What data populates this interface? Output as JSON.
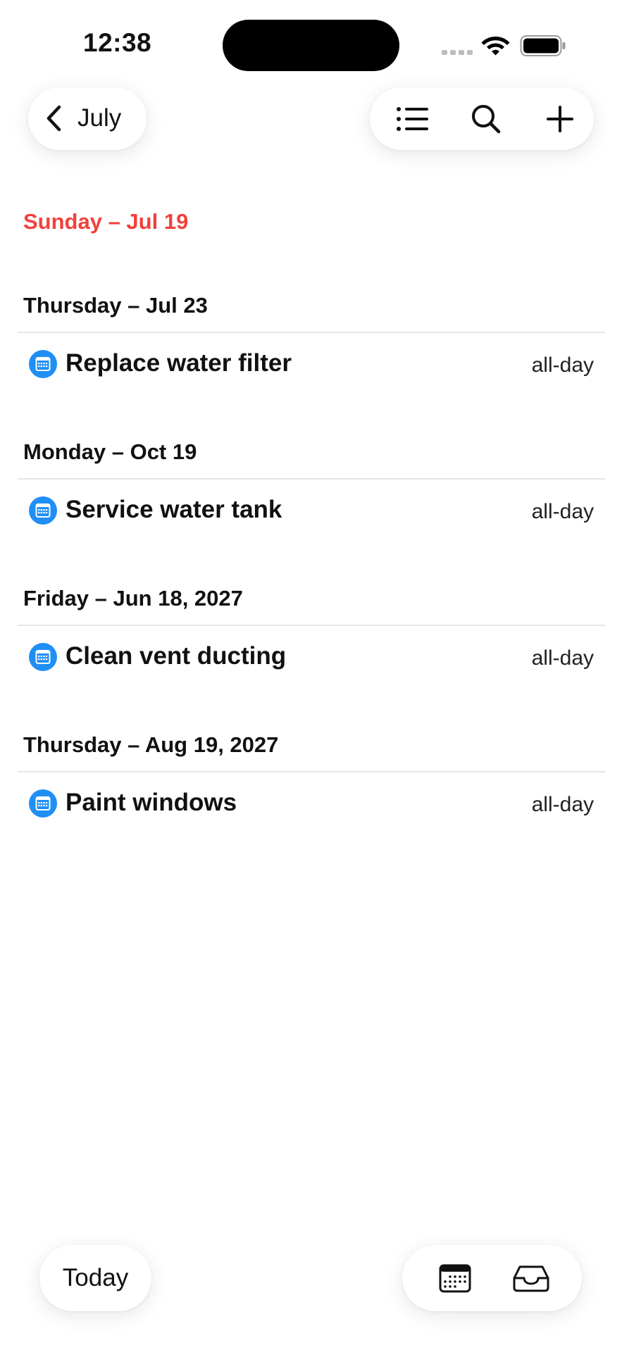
{
  "status_bar": {
    "time": "12:38"
  },
  "nav": {
    "back_label": "July",
    "icons": [
      "chevron-left-icon",
      "list-icon",
      "search-icon",
      "plus-icon"
    ]
  },
  "colors": {
    "today_header": "#f1413c",
    "event_icon": "#1f8ff5",
    "text": "#111111"
  },
  "days": [
    {
      "header": "Sunday – Jul 19",
      "is_today": true,
      "events": []
    },
    {
      "header": "Thursday – Jul 23",
      "is_today": false,
      "events": [
        {
          "title": "Replace water filter",
          "time": "all-day",
          "icon": "calendar-icon"
        }
      ]
    },
    {
      "header": "Monday – Oct 19",
      "is_today": false,
      "events": [
        {
          "title": "Service water tank",
          "time": "all-day",
          "icon": "calendar-icon"
        }
      ]
    },
    {
      "header": "Friday – Jun 18, 2027",
      "is_today": false,
      "events": [
        {
          "title": "Clean vent ducting",
          "time": "all-day",
          "icon": "calendar-icon"
        }
      ]
    },
    {
      "header": "Thursday – Aug 19, 2027",
      "is_today": false,
      "events": [
        {
          "title": "Paint windows",
          "time": "all-day",
          "icon": "calendar-icon"
        }
      ]
    }
  ],
  "bottom_bar": {
    "today_label": "Today",
    "icons": [
      "calendar-icon",
      "inbox-icon"
    ]
  }
}
